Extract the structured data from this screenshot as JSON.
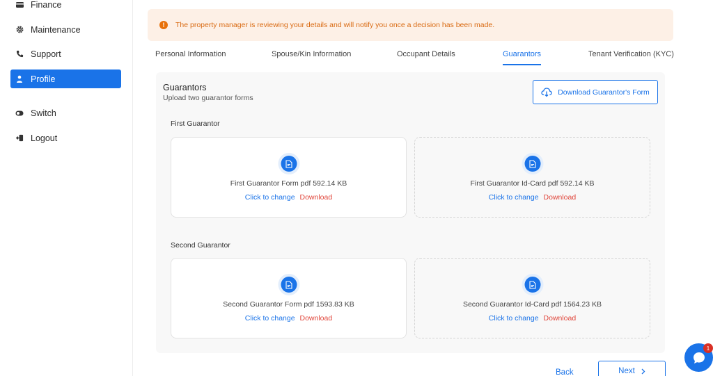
{
  "sidebar": {
    "items": [
      {
        "label": "Finance",
        "icon": "wallet-icon"
      },
      {
        "label": "Maintenance",
        "icon": "gear-icon"
      },
      {
        "label": "Support",
        "icon": "phone-icon"
      },
      {
        "label": "Profile",
        "icon": "user-icon",
        "active": true
      },
      {
        "label": "Switch",
        "icon": "switch-icon"
      },
      {
        "label": "Logout",
        "icon": "logout-icon"
      }
    ]
  },
  "alert": {
    "message": "The property manager is reviewing your details and will notify you once a decision has been made.",
    "color": "#e8710a"
  },
  "tabs": [
    {
      "label": "Personal Information"
    },
    {
      "label": "Spouse/Kin Information"
    },
    {
      "label": "Occupant Details"
    },
    {
      "label": "Guarantors",
      "active": true
    },
    {
      "label": "Tenant Verification (KYC)"
    }
  ],
  "guarantors": {
    "title": "Guarantors",
    "subtitle": "Upload two guarantor forms",
    "download_form_label": "Download Guarantor's Form",
    "first": {
      "label": "First Guarantor",
      "files": [
        {
          "name": "First Guarantor Form pdf 592.14 KB",
          "change": "Click to change",
          "download": "Download"
        },
        {
          "name": "First Guarantor Id-Card pdf 592.14 KB",
          "change": "Click to change",
          "download": "Download"
        }
      ]
    },
    "second": {
      "label": "Second Guarantor",
      "files": [
        {
          "name": "Second Guarantor Form pdf 1593.83 KB",
          "change": "Click to change",
          "download": "Download"
        },
        {
          "name": "Second Guarantor Id-Card pdf 1564.23 KB",
          "change": "Click to change",
          "download": "Download"
        }
      ]
    }
  },
  "footer": {
    "back_label": "Back",
    "next_label": "Next",
    "chat_badge": "1"
  },
  "colors": {
    "accent": "#1a73e8",
    "danger": "#e0453a",
    "warning": "#e8710a"
  }
}
